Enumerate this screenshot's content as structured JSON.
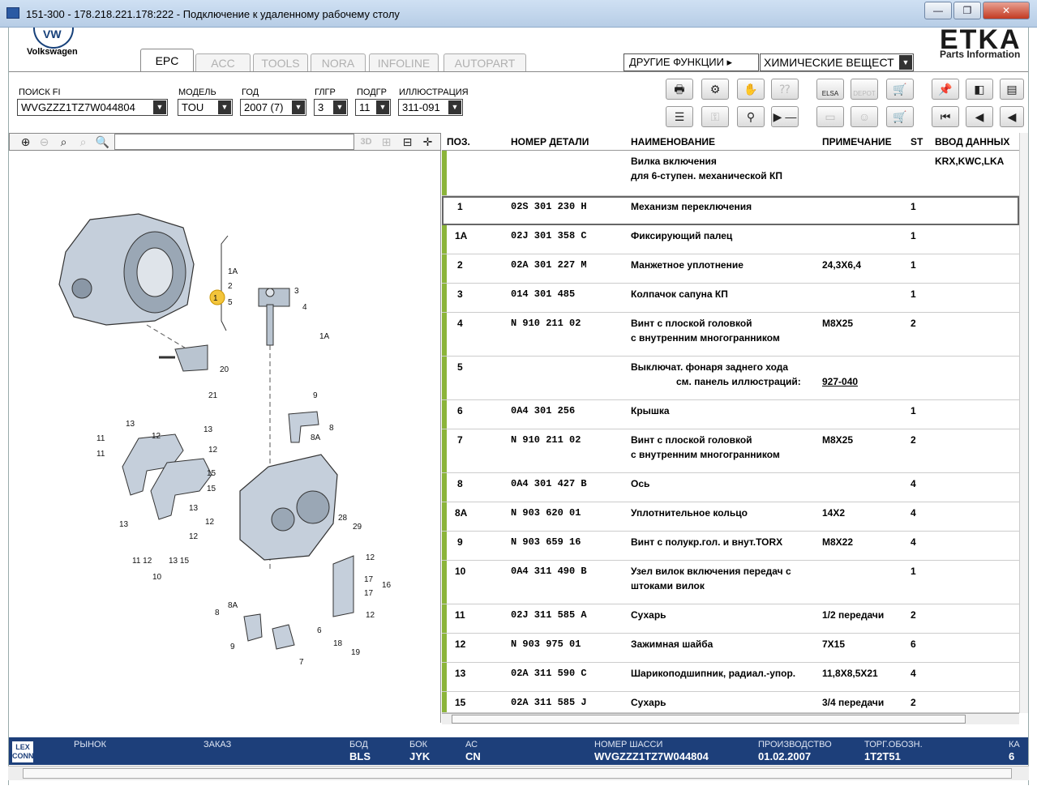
{
  "window": {
    "title": "151-300 - 178.218.221.178:222 - Подключение к удаленному рабочему столу",
    "minimize": "—",
    "restore": "❐",
    "close": "✕"
  },
  "app": {
    "brand": "Volkswagen",
    "logo_text": "VW",
    "product": "ETKA",
    "product_sub": "Parts Information"
  },
  "tabs": [
    "EPC",
    "ACC",
    "TOOLS",
    "NORA",
    "INFOLINE",
    "AUTOPART"
  ],
  "other_functions": {
    "label": "ДРУГИЕ ФУНКЦИИ ▸",
    "value": "ХИМИЧЕСКИЕ ВЕЩЕСТ"
  },
  "filters": [
    {
      "label": "ПОИСК FI",
      "value": "WVGZZZ1TZ7W044804"
    },
    {
      "label": "МОДЕЛЬ",
      "value": "TOU"
    },
    {
      "label": "ГОД",
      "value": "2007 (7)"
    },
    {
      "label": "ГЛГР",
      "value": "3"
    },
    {
      "label": "ПОДГР",
      "value": "11"
    },
    {
      "label": "ИЛЛЮСТРАЦИЯ",
      "value": "311-091"
    }
  ],
  "toolbar_icons": {
    "row1": [
      "print-icon",
      "parts-icon",
      "hands-icon",
      "question-icon",
      "elsa-icon",
      "depot-icon",
      "cart-move-icon",
      "pin-icon",
      "book-back-icon",
      "doc-icon"
    ],
    "row2": [
      "list-icon",
      "key-icon",
      "bike-icon",
      "play-minus-icon",
      "elsa2-icon",
      "user-icon",
      "cart-icon",
      "first-icon",
      "prev-icon",
      "back-icon"
    ],
    "elsa": "ELSA",
    "depot": "DEPOT"
  },
  "zoom_tools": {
    "view3d": "3D"
  },
  "table": {
    "headers": {
      "pos": "ПОЗ.",
      "part": "НОМЕР ДЕТАЛИ",
      "name": "НАИМЕНОВАНИЕ",
      "note": "ПРИМЕЧАНИЕ",
      "qty": "ST",
      "input": "ВВОД ДАННЫХ"
    },
    "rows": [
      {
        "pos": "",
        "part": "",
        "name": "Вилка включения",
        "name2": "для 6-ступен. механической КП",
        "note": "",
        "qty": "",
        "input": "KRX,KWC,LKA"
      },
      {
        "pos": "1",
        "part": "02S 301 230 H",
        "name": "Механизм переключения",
        "name2": "",
        "note": "",
        "qty": "1",
        "input": ""
      },
      {
        "pos": "1A",
        "part": "02J 301 358 C",
        "name": "Фиксирующий палец",
        "name2": "",
        "note": "",
        "qty": "1",
        "input": ""
      },
      {
        "pos": "2",
        "part": "02A 301 227 M",
        "name": "Манжетное уплотнение",
        "name2": "",
        "note": "24,3X6,4",
        "qty": "1",
        "input": ""
      },
      {
        "pos": "3",
        "part": "014 301 485",
        "name": "Колпачок сапуна КП",
        "name2": "",
        "note": "",
        "qty": "1",
        "input": ""
      },
      {
        "pos": "4",
        "part": "N   910 211 02",
        "name": "Винт с плоской головкой",
        "name2": "с внутренним многогранником",
        "note": "M8X25",
        "qty": "2",
        "input": ""
      },
      {
        "pos": "5",
        "part": "",
        "name": "Выключат. фонаря заднего хода",
        "name2": "см. панель иллюстраций:",
        "note": "927-040",
        "qty": "",
        "input": ""
      },
      {
        "pos": "6",
        "part": "0A4 301 256",
        "name": "Крышка",
        "name2": "",
        "note": "",
        "qty": "1",
        "input": ""
      },
      {
        "pos": "7",
        "part": "N   910 211 02",
        "name": "Винт с плоской головкой",
        "name2": "с внутренним многогранником",
        "note": "M8X25",
        "qty": "2",
        "input": ""
      },
      {
        "pos": "8",
        "part": "0A4 301 427 B",
        "name": "Ось",
        "name2": "",
        "note": "",
        "qty": "4",
        "input": ""
      },
      {
        "pos": "8A",
        "part": "N   903 620 01",
        "name": "Уплотнительное кольцо",
        "name2": "",
        "note": "14X2",
        "qty": "4",
        "input": ""
      },
      {
        "pos": "9",
        "part": "N   903 659 16",
        "name": "Винт с полукр.гол. и внут.TORX",
        "name2": "",
        "note": "M8X22",
        "qty": "4",
        "input": ""
      },
      {
        "pos": "10",
        "part": "0A4 311 490 B",
        "name": "Узел вилок включения передач с",
        "name2": "штоками вилок",
        "note": "",
        "qty": "1",
        "input": ""
      },
      {
        "pos": "11",
        "part": "02J 311 585 A",
        "name": "Сухарь",
        "name2": "",
        "note": "1/2 передачи",
        "qty": "2",
        "input": ""
      },
      {
        "pos": "12",
        "part": "N   903 975 01",
        "name": "Зажимная шайба",
        "name2": "",
        "note": "7X15",
        "qty": "6",
        "input": ""
      },
      {
        "pos": "13",
        "part": "02A 311 590 C",
        "name": "Шарикоподшипник, радиал.-упор.",
        "name2": "",
        "note": "11,8X8,5X21",
        "qty": "4",
        "input": ""
      },
      {
        "pos": "15",
        "part": "02A 311 585 J",
        "name": "Сухарь",
        "name2": "",
        "note": "3/4 передачи",
        "qty": "2",
        "input": ""
      }
    ]
  },
  "status": {
    "logo": "LEX CONN",
    "items": [
      {
        "label": "РЫНОК",
        "value": ""
      },
      {
        "label": "ЗАКАЗ",
        "value": ""
      },
      {
        "label": "БОД",
        "value": "BLS"
      },
      {
        "label": "БОК",
        "value": "JYK"
      },
      {
        "label": "АС",
        "value": "CN"
      },
      {
        "label": "НОМЕР ШАССИ",
        "value": "WVGZZZ1TZ7W044804"
      },
      {
        "label": "ПРОИЗВОДСТВО",
        "value": "01.02.2007"
      },
      {
        "label": "ТОРГ.ОБОЗН.",
        "value": "1T2T51"
      },
      {
        "label": "КА",
        "value": "6"
      }
    ]
  },
  "callouts": [
    "1A",
    "2",
    "3",
    "5",
    "4",
    "1A",
    "1",
    "20",
    "21",
    "9",
    "8",
    "8A",
    "13",
    "12",
    "13",
    "11",
    "11",
    "12",
    "12",
    "15",
    "15",
    "13",
    "12",
    "13",
    "11 12",
    "13 15",
    "10",
    "28",
    "29",
    "12",
    "17",
    "17",
    "16",
    "12",
    "8A",
    "8",
    "6",
    "9",
    "7",
    "18",
    "19"
  ]
}
